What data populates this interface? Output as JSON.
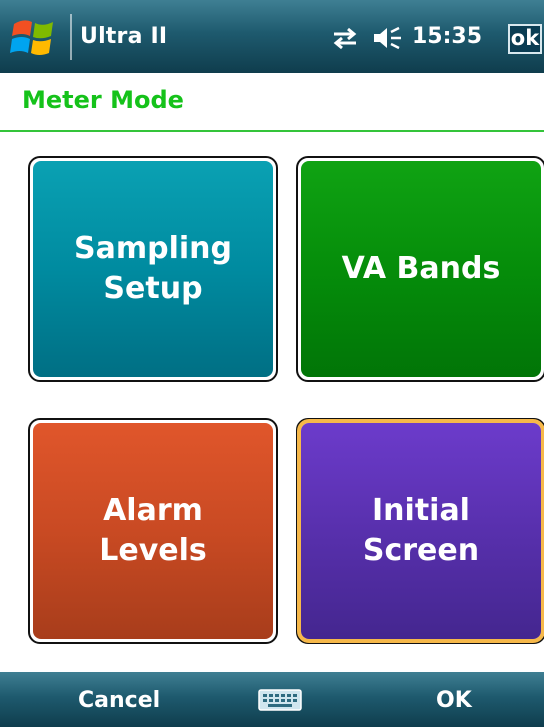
{
  "titlebar": {
    "app_title": "Ultra II",
    "clock": "15:35",
    "ok_label": "ok",
    "icons": [
      "windows-start-icon",
      "connectivity-icon",
      "volume-icon"
    ]
  },
  "page": {
    "title": "Meter Mode"
  },
  "tiles": [
    {
      "line1": "Sampling",
      "line2": "Setup",
      "color": "#008ba0"
    },
    {
      "line1": "VA Bands",
      "line2": "",
      "color": "#058d0a"
    },
    {
      "line1": "Alarm",
      "line2": "Levels",
      "color": "#c94a23"
    },
    {
      "line1": "Initial",
      "line2": "Screen",
      "color": "#5830ad",
      "selected": true,
      "selection_color": "#f6b84a"
    }
  ],
  "softkeys": {
    "left": "Cancel",
    "right": "OK",
    "center_icon": "keyboard-icon"
  },
  "colors": {
    "bar_gradient_top": "#3f7f93",
    "bar_gradient_bottom": "#0f3d4d",
    "title_green": "#15c21a"
  }
}
